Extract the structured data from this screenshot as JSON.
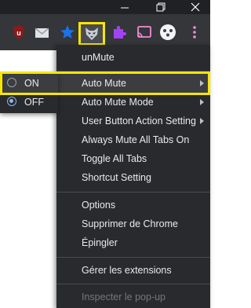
{
  "menu": {
    "title": "unMute",
    "items": [
      {
        "label": "Auto Mute"
      },
      {
        "label": "Auto Mute Mode"
      },
      {
        "label": "User Button Action Setting"
      },
      {
        "label": "Always Mute All Tabs On"
      },
      {
        "label": "Toggle All Tabs"
      },
      {
        "label": "Shortcut Setting"
      },
      {
        "label": "Options"
      },
      {
        "label": "Supprimer de Chrome"
      },
      {
        "label": "Épingler"
      },
      {
        "label": "Gérer les extensions"
      },
      {
        "label": "Inspecter le pop-up"
      }
    ]
  },
  "submenu": {
    "options": [
      {
        "label": "ON",
        "selected": false
      },
      {
        "label": "OFF",
        "selected": true
      }
    ]
  },
  "icons": {
    "window": [
      "minimize-icon",
      "maximize-icon",
      "close-icon"
    ],
    "extensions": [
      "ublock-icon",
      "mail-icon",
      "star-extension-icon",
      "unmute-extension-icon",
      "puzzle-extensions-icon",
      "cast-icon",
      "profile-avatar-icon",
      "more-menu-icon"
    ]
  },
  "colors": {
    "highlight": "#f6e600",
    "menu_bg": "#292a2d",
    "toolbar_bg": "#35363a",
    "accent": "#8ab4f8"
  }
}
